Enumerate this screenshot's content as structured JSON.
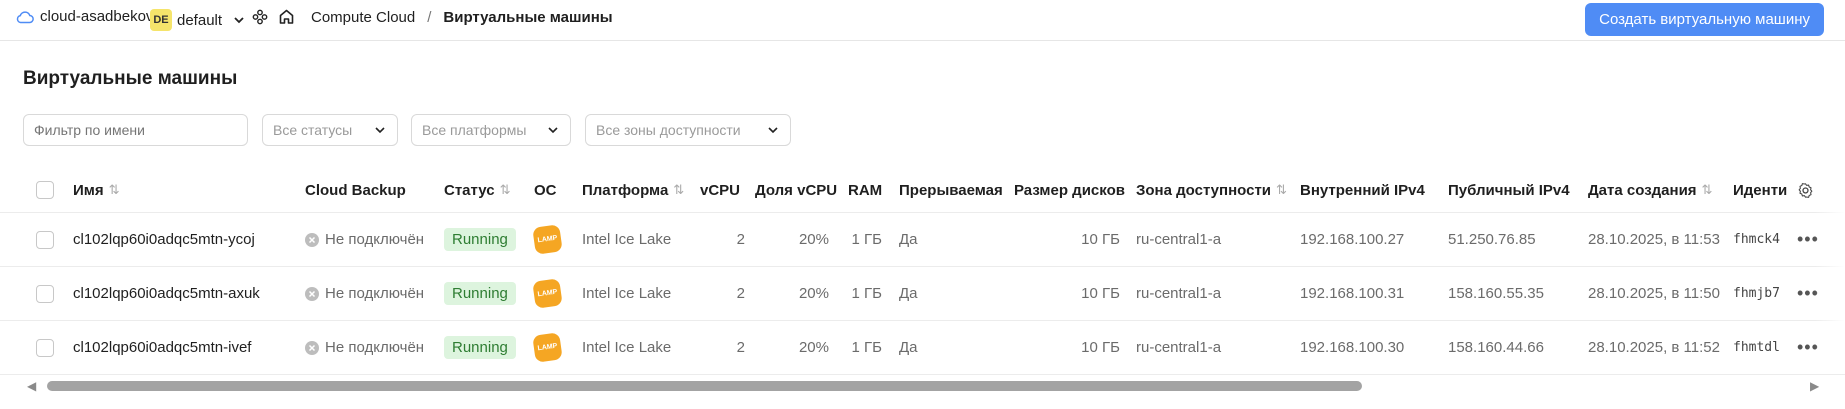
{
  "header": {
    "cloud_name": "cloud-asadbekov-a",
    "folder_badge": "DE",
    "folder_name": "default",
    "breadcrumb_service": "Compute Cloud",
    "breadcrumb_separator": "/",
    "breadcrumb_current": "Виртуальные машины",
    "create_button": "Создать виртуальную машину"
  },
  "page": {
    "title": "Виртуальные машины"
  },
  "filters": {
    "name_placeholder": "Фильтр по имени",
    "status": "Все статусы",
    "platform": "Все платформы",
    "zone": "Все зоны доступности"
  },
  "table": {
    "columns": {
      "name": "Имя",
      "backup": "Cloud Backup",
      "status": "Статус",
      "os": "ОС",
      "platform": "Платформа",
      "vcpu": "vCPU",
      "vcpu_share": "Доля vCPU",
      "ram": "RAM",
      "preemptible": "Прерываемая",
      "disk_size": "Размер дисков",
      "zone": "Зона доступности",
      "internal_ip": "Внутренний IPv4",
      "public_ip": "Публичный IPv4",
      "created": "Дата создания",
      "id": "Иденти"
    },
    "rows": [
      {
        "name": "cl102lqp60i0adqc5mtn-ycoj",
        "backup": "Не подключён",
        "status": "Running",
        "os": "LAMP",
        "platform": "Intel Ice Lake",
        "vcpu": "2",
        "vcpu_share": "20%",
        "ram": "1 ГБ",
        "preemptible": "Да",
        "disk_size": "10 ГБ",
        "zone": "ru-central1-a",
        "internal_ip": "192.168.100.27",
        "public_ip": "51.250.76.85",
        "created": "28.10.2025, в 11:53",
        "id": "fhmck4"
      },
      {
        "name": "cl102lqp60i0adqc5mtn-axuk",
        "backup": "Не подключён",
        "status": "Running",
        "os": "LAMP",
        "platform": "Intel Ice Lake",
        "vcpu": "2",
        "vcpu_share": "20%",
        "ram": "1 ГБ",
        "preemptible": "Да",
        "disk_size": "10 ГБ",
        "zone": "ru-central1-a",
        "internal_ip": "192.168.100.31",
        "public_ip": "158.160.55.35",
        "created": "28.10.2025, в 11:50",
        "id": "fhmjb7"
      },
      {
        "name": "cl102lqp60i0adqc5mtn-ivef",
        "backup": "Не подключён",
        "status": "Running",
        "os": "LAMP",
        "platform": "Intel Ice Lake",
        "vcpu": "2",
        "vcpu_share": "20%",
        "ram": "1 ГБ",
        "preemptible": "Да",
        "disk_size": "10 ГБ",
        "zone": "ru-central1-a",
        "internal_ip": "192.168.100.30",
        "public_ip": "158.160.44.66",
        "created": "28.10.2025, в 11:52",
        "id": "fhmtdl"
      }
    ]
  },
  "colors": {
    "accent": "#4f8cf5",
    "status_bg": "#ddf4de",
    "status_text": "#2e7d32",
    "lamp": "#f5a623"
  },
  "icons": [
    "cloud-icon",
    "chevron-down-icon",
    "services-icon",
    "home-icon",
    "sort-icon",
    "settings-icon",
    "not-connected-icon",
    "more-icon"
  ]
}
